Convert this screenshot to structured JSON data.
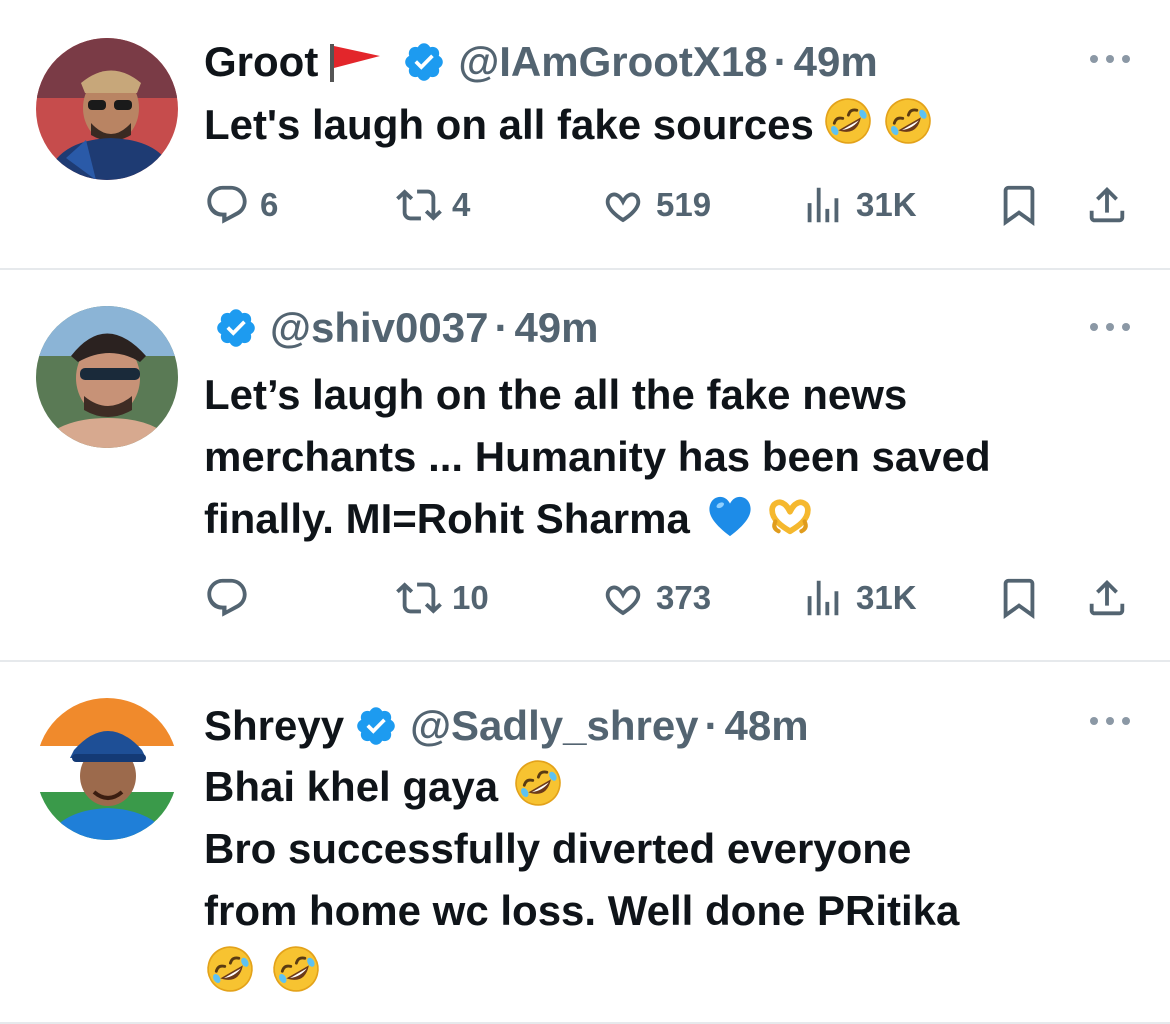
{
  "tweets": [
    {
      "name": "Groot",
      "flag": "red-flag",
      "handle": "@IAmGrootX18",
      "dot": "·",
      "time": "49m",
      "lines": [
        "Let's laugh on all fake sources"
      ],
      "emoji": [
        "rolling-on-floor-laughing",
        "rolling-on-floor-laughing"
      ],
      "replies": "6",
      "retweets": "4",
      "likes": "519",
      "views": "31K"
    },
    {
      "name": "",
      "handle": "@shiv0037",
      "dot": "·",
      "time": "49m",
      "lines": [
        "Let’s laugh on the all the fake news",
        "merchants ... Humanity has been saved",
        "finally. MI=Rohit Sharma"
      ],
      "emoji": [
        "blue-heart",
        "heart-hands"
      ],
      "replies": "",
      "retweets": "10",
      "likes": "373",
      "views": "31K"
    },
    {
      "name": "Shreyy",
      "handle": "@Sadly_shrey",
      "dot": "·",
      "time": "48m",
      "lines": [
        "Bhai khel gaya",
        "Bro successfully diverted everyone",
        "from home wc loss. Well done PRitika",
        ""
      ],
      "emoji": [
        "rolling-on-floor-laughing",
        "rolling-on-floor-laughing"
      ]
    }
  ],
  "colors": {
    "text": "#0f1419",
    "secondary": "#536471",
    "verified": "#1d9bf0",
    "divider": "#e6e9ec"
  }
}
